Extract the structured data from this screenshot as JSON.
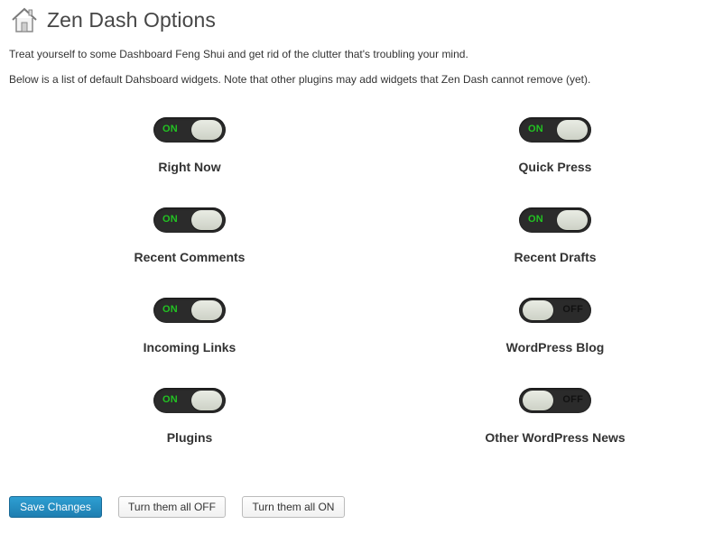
{
  "page": {
    "title": "Zen Dash Options",
    "icon": "home-icon",
    "intro": "Treat yourself to some Dashboard Feng Shui and get rid of the clutter that's troubling your mind.",
    "note": "Below is a list of default Dahsboard widgets. Note that other plugins may add widgets that Zen Dash cannot remove (yet)."
  },
  "widgets": [
    {
      "label": "Right Now",
      "state": "ON"
    },
    {
      "label": "Quick Press",
      "state": "ON"
    },
    {
      "label": "Recent Comments",
      "state": "ON"
    },
    {
      "label": "Recent Drafts",
      "state": "ON"
    },
    {
      "label": "Incoming Links",
      "state": "ON"
    },
    {
      "label": "WordPress Blog",
      "state": "OFF"
    },
    {
      "label": "Plugins",
      "state": "ON"
    },
    {
      "label": "Other WordPress News",
      "state": "OFF"
    }
  ],
  "buttons": {
    "save": "Save Changes",
    "all_off": "Turn them all OFF",
    "all_on": "Turn them all ON"
  },
  "colors": {
    "on_text": "#22c322",
    "primary_button": "#2a8fc7",
    "toggle_track": "#2b2b2b"
  }
}
